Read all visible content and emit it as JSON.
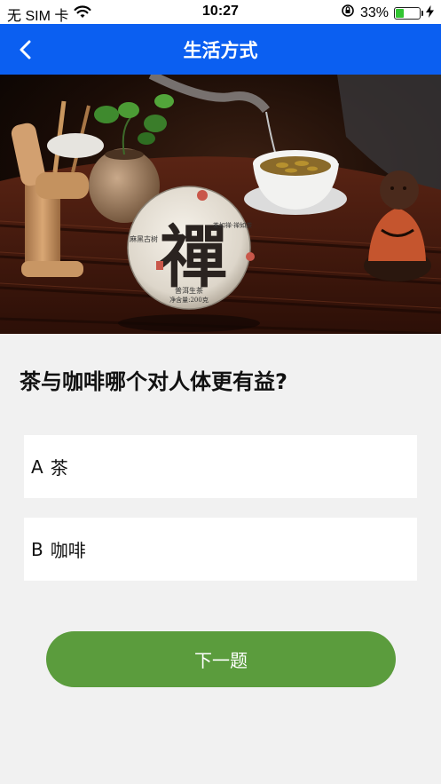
{
  "status_bar": {
    "carrier": "无 SIM 卡",
    "time": "10:27",
    "battery_percent": "33%",
    "battery_level": 0.33,
    "battery_color": "#32c532",
    "icons": [
      "wifi-icon",
      "rotation-lock-icon",
      "battery-icon",
      "charging-icon"
    ]
  },
  "nav": {
    "title": "生活方式",
    "back_icon": "chevron-left-icon",
    "background": "#0b5ff1"
  },
  "hero": {
    "description_icon": "tea-ceremony-image",
    "cake_calligraphy": "禪",
    "cake_small_left": "麻黑古树",
    "cake_small_right": "茶如禅·禅如茶",
    "cake_bottom_line1": "普洱生茶",
    "cake_bottom_line2": "净含量:200克"
  },
  "quiz": {
    "question": "茶与咖啡哪个对人体更有益?",
    "options": [
      {
        "letter": "A",
        "text": "茶"
      },
      {
        "letter": "B",
        "text": "咖啡"
      }
    ],
    "next_label": "下一题",
    "next_color": "#5b9c3d"
  }
}
